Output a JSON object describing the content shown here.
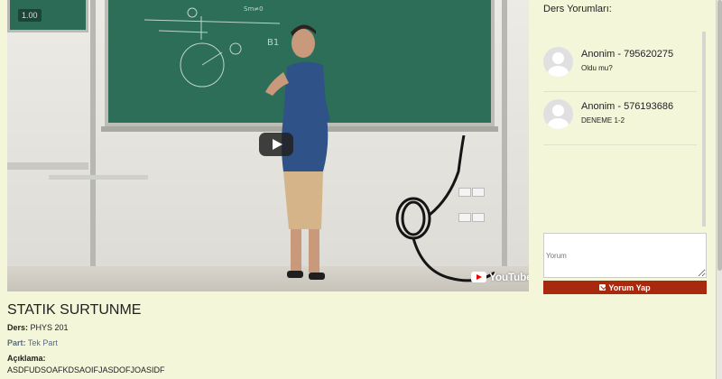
{
  "video": {
    "timestamp": "1.00",
    "youtube_label": "YouTube"
  },
  "lesson": {
    "title": "STATIK SURTUNME",
    "course_label": "Ders:",
    "course_value": "PHYS 201",
    "part_label": "Part:",
    "part_value": "Tek Part",
    "description_label": "Açıklama:",
    "description_value": "ASDFUDSOAFKDSAOIFJASDOFJOASIDF"
  },
  "comments_panel": {
    "title": "Ders Yorumları:",
    "items": [
      {
        "author": "Anonim - 795620275",
        "text": "Oldu mu?"
      },
      {
        "author": "Anonim - 576193686",
        "text": "DENEME 1-2"
      }
    ],
    "input_placeholder": "Yorum",
    "submit_label": "Yorum Yap"
  },
  "icons": {
    "play": "play-icon",
    "youtube": "youtube-logo",
    "avatar": "user-avatar-icon",
    "submit": "edit-icon"
  },
  "colors": {
    "background": "#f3f6d9",
    "submit_button": "#a8290e",
    "chalkboard": "#2d6e59"
  }
}
